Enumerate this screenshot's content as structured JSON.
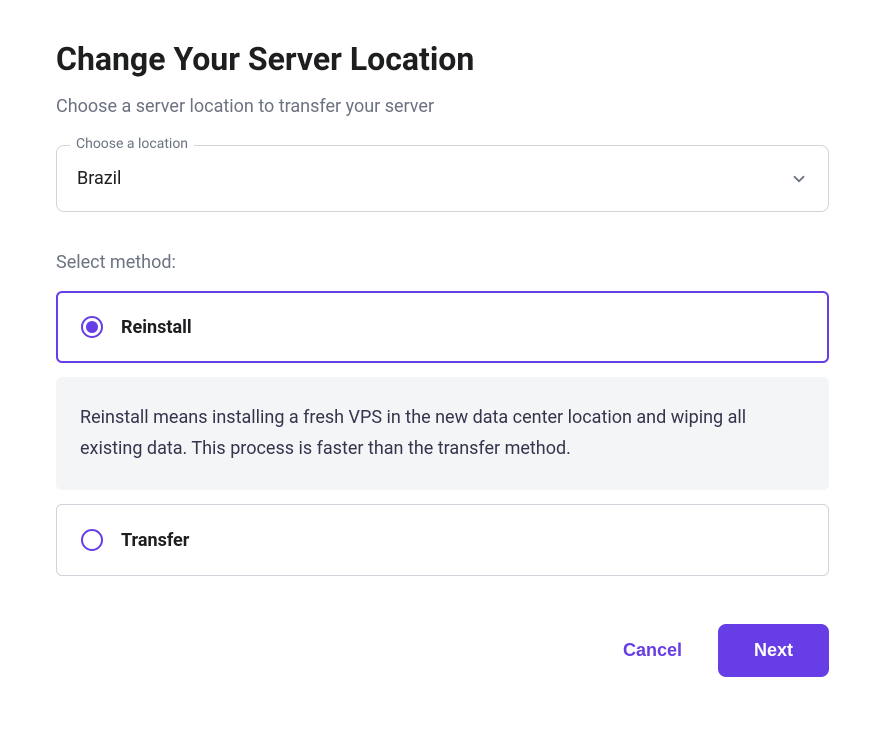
{
  "title": "Change Your Server Location",
  "subtitle": "Choose a server location to transfer your server",
  "location_select": {
    "label": "Choose a location",
    "value": "Brazil"
  },
  "method_label": "Select method:",
  "options": {
    "reinstall": {
      "title": "Reinstall",
      "selected": true,
      "description": "Reinstall means installing a fresh VPS in the new data center location and wiping all existing data. This process is faster than the transfer method."
    },
    "transfer": {
      "title": "Transfer",
      "selected": false
    }
  },
  "buttons": {
    "cancel": "Cancel",
    "next": "Next"
  },
  "colors": {
    "accent": "#673de6"
  }
}
